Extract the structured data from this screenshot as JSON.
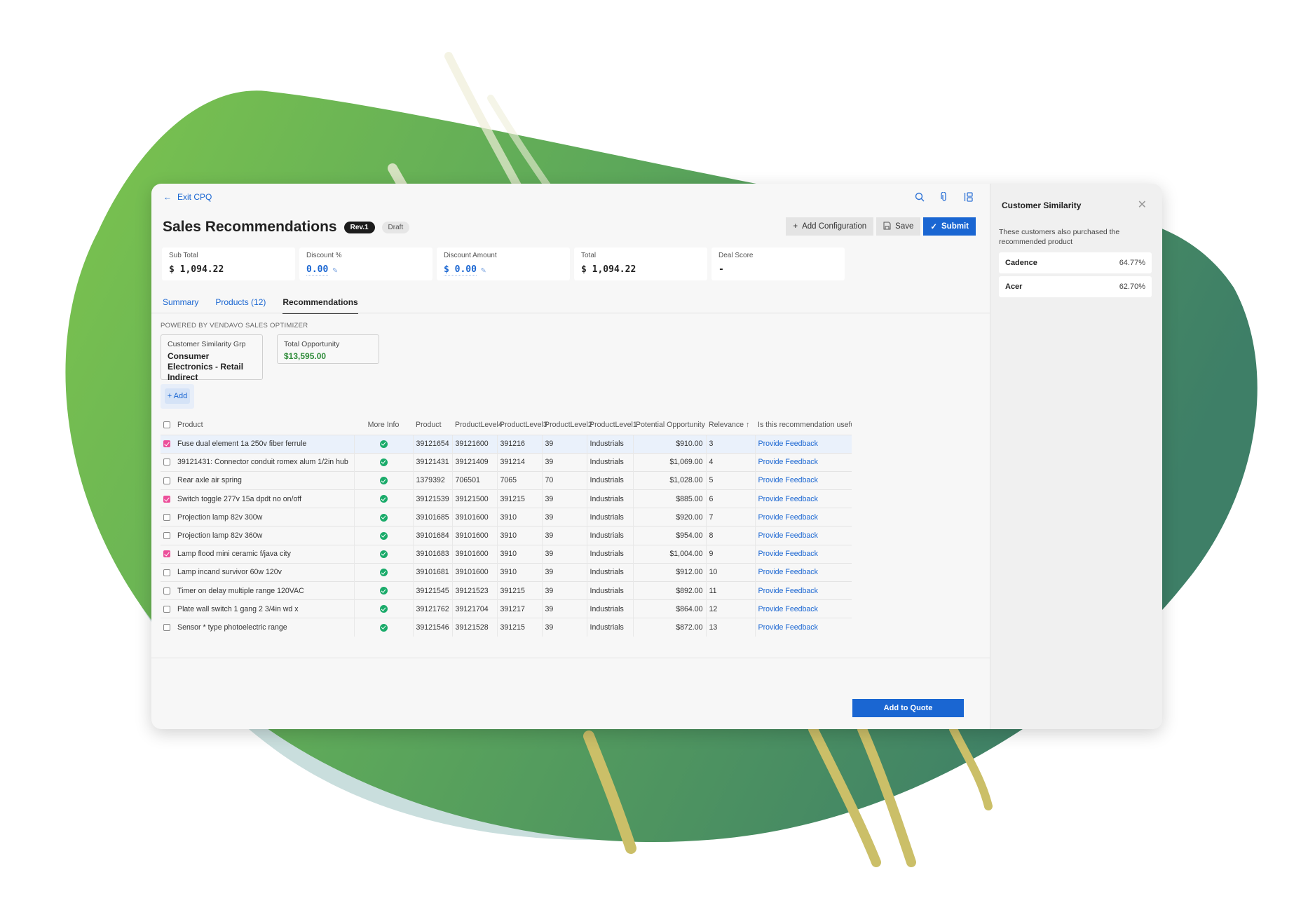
{
  "nav": {
    "exit_label": "Exit CPQ"
  },
  "header": {
    "title": "Sales Recommendations",
    "revision_badge": "Rev.1",
    "status_badge": "Draft",
    "actions": {
      "add_configuration": "Add Configuration",
      "save": "Save",
      "submit": "Submit"
    }
  },
  "kpis": [
    {
      "label": "Sub Total",
      "value": "$ 1,094.22"
    },
    {
      "label": "Discount %",
      "value": "0.00"
    },
    {
      "label": "Discount Amount",
      "value": "$ 0.00"
    },
    {
      "label": "Total",
      "value": "$ 1,094.22"
    },
    {
      "label": "Deal Score",
      "value": "-"
    }
  ],
  "tabs": [
    {
      "label": "Summary"
    },
    {
      "label": "Products (12)"
    },
    {
      "label": "Recommendations",
      "active": true
    }
  ],
  "powered_by": "POWERED BY VENDAVO SALES OPTIMIZER",
  "info_cards": {
    "similarity_group": {
      "label": "Customer Similarity Grp",
      "value": "Consumer Electronics - Retail Indirect"
    },
    "total_opportunity": {
      "label": "Total Opportunity",
      "value": "$13,595.00"
    }
  },
  "add_button": "+ Add",
  "table": {
    "columns": [
      "Product",
      "More Info",
      "Product",
      "ProductLevel4",
      "ProductLevel3",
      "ProductLevel2",
      "ProductLevel1",
      "Potential Opportunity",
      "Relevance ↑",
      "Is this recommendation useful"
    ],
    "rows": [
      {
        "checked": true,
        "name": "Fuse dual element 1a 250v fiber ferrule",
        "product": "39121654",
        "l4": "39121600",
        "l3": "391216",
        "l2": "39",
        "l1": "Industrials",
        "opportunity": "$910.00",
        "relevance": "3",
        "feedback": "Provide Feedback"
      },
      {
        "checked": false,
        "name": "39121431: Connector conduit romex alum 1/2in hub",
        "product": "39121431",
        "l4": "39121409",
        "l3": "391214",
        "l2": "39",
        "l1": "Industrials",
        "opportunity": "$1,069.00",
        "relevance": "4",
        "feedback": "Provide Feedback"
      },
      {
        "checked": false,
        "name": "Rear axle air spring",
        "product": "1379392",
        "l4": "706501",
        "l3": "7065",
        "l2": "70",
        "l1": "Industrials",
        "opportunity": "$1,028.00",
        "relevance": "5",
        "feedback": "Provide Feedback"
      },
      {
        "checked": true,
        "name": "Switch toggle 277v 15a dpdt no on/off",
        "product": "39121539",
        "l4": "39121500",
        "l3": "391215",
        "l2": "39",
        "l1": "Industrials",
        "opportunity": "$885.00",
        "relevance": "6",
        "feedback": "Provide Feedback"
      },
      {
        "checked": false,
        "name": "Projection lamp 82v 300w",
        "product": "39101685",
        "l4": "39101600",
        "l3": "3910",
        "l2": "39",
        "l1": "Industrials",
        "opportunity": "$920.00",
        "relevance": "7",
        "feedback": "Provide Feedback"
      },
      {
        "checked": false,
        "name": "Projection lamp 82v 360w",
        "product": "39101684",
        "l4": "39101600",
        "l3": "3910",
        "l2": "39",
        "l1": "Industrials",
        "opportunity": "$954.00",
        "relevance": "8",
        "feedback": "Provide Feedback"
      },
      {
        "checked": true,
        "name": "Lamp flood mini ceramic f/java city",
        "product": "39101683",
        "l4": "39101600",
        "l3": "3910",
        "l2": "39",
        "l1": "Industrials",
        "opportunity": "$1,004.00",
        "relevance": "9",
        "feedback": "Provide Feedback"
      },
      {
        "checked": false,
        "name": "Lamp incand survivor 60w 120v",
        "product": "39101681",
        "l4": "39101600",
        "l3": "3910",
        "l2": "39",
        "l1": "Industrials",
        "opportunity": "$912.00",
        "relevance": "10",
        "feedback": "Provide Feedback"
      },
      {
        "checked": false,
        "name": "Timer on delay multiple range 120VAC",
        "product": "39121545",
        "l4": "39121523",
        "l3": "391215",
        "l2": "39",
        "l1": "Industrials",
        "opportunity": "$892.00",
        "relevance": "11",
        "feedback": "Provide Feedback"
      },
      {
        "checked": false,
        "name": "Plate wall switch 1 gang 2 3/4in wd x",
        "product": "39121762",
        "l4": "39121704",
        "l3": "391217",
        "l2": "39",
        "l1": "Industrials",
        "opportunity": "$864.00",
        "relevance": "12",
        "feedback": "Provide Feedback"
      },
      {
        "checked": false,
        "name": "Sensor * type photoelectric range",
        "product": "39121546",
        "l4": "39121528",
        "l3": "391215",
        "l2": "39",
        "l1": "Industrials",
        "opportunity": "$872.00",
        "relevance": "13",
        "feedback": "Provide Feedback"
      }
    ]
  },
  "footer": {
    "add_to_quote": "Add to Quote"
  },
  "side_panel": {
    "title": "Customer Similarity",
    "description": "These customers also purchased the recommended product",
    "customers": [
      {
        "name": "Cadence",
        "similarity": "64.77%"
      },
      {
        "name": "Acer",
        "similarity": "62.70%"
      }
    ]
  },
  "colors": {
    "accent_blue": "#1a66d2",
    "checkbox_pink": "#ec4f9a",
    "success_green": "#1aab6a",
    "opportunity_green": "#2f8c3a"
  }
}
